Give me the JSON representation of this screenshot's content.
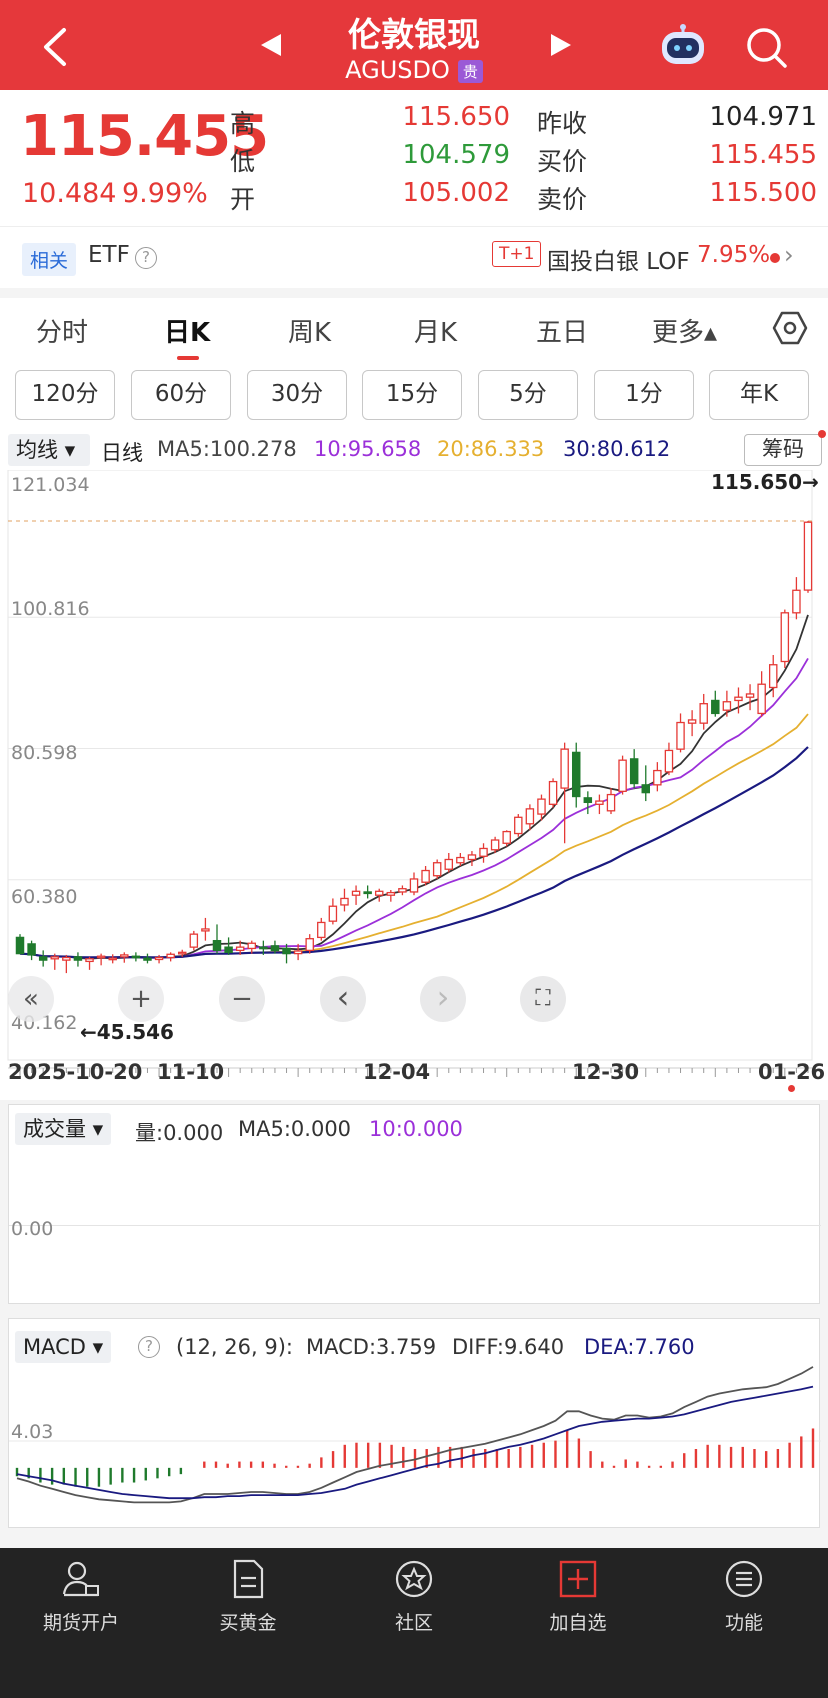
{
  "header": {
    "title": "伦敦银现",
    "symbol": "AGUSDO",
    "tag": "贵"
  },
  "quote": {
    "price": "115.455",
    "change": "10.484",
    "change_pct": "9.99%",
    "high_label": "高",
    "high": "115.650",
    "low_label": "低",
    "low": "104.579",
    "open_label": "开",
    "open": "105.002",
    "prev_close_label": "昨收",
    "prev_close": "104.971",
    "bid_label": "买价",
    "bid": "115.455",
    "ask_label": "卖价",
    "ask": "115.500"
  },
  "related": {
    "tag": "相关",
    "etf": "ETF",
    "help": "?",
    "lof_badge": "T+1",
    "lof_name": "国投白银 LOF",
    "lof_pct": "7.95%",
    "chevron": "›"
  },
  "tabs": [
    "分时",
    "日K",
    "周K",
    "月K",
    "五日",
    "更多▴"
  ],
  "active_tab": "日K",
  "intervals": [
    "120分",
    "60分",
    "30分",
    "15分",
    "5分",
    "1分",
    "年K"
  ],
  "ma_row": {
    "selector": "均线 ▾",
    "line_type": "日线",
    "ma5": "MA5:100.278",
    "ma10": "10:95.658",
    "ma20": "20:86.333",
    "ma30": "30:80.612",
    "chip_button": "筹码"
  },
  "colors": {
    "up": "#e53935",
    "down": "#1f7a2c",
    "ma5": "#333333",
    "ma10": "#9b30d9",
    "ma20": "#e5b030",
    "ma30": "#1a1a80"
  },
  "chart_data": [
    {
      "type": "candlestick",
      "title": "",
      "y_ticks": [
        "121.034",
        "100.816",
        "80.598",
        "60.380",
        "40.162"
      ],
      "ylim": [
        40.162,
        121.034
      ],
      "x_tick_labels": [
        "2025-10-20",
        "11-10",
        "12-04",
        "12-30",
        "01-26"
      ],
      "high_marker": "115.650→",
      "low_marker": "←45.546",
      "x": [
        "10-20",
        "10-21",
        "10-22",
        "10-23",
        "10-24",
        "10-27",
        "10-28",
        "10-29",
        "10-30",
        "10-31",
        "11-03",
        "11-04",
        "11-05",
        "11-06",
        "11-07",
        "11-10",
        "11-11",
        "11-12",
        "11-13",
        "11-14",
        "11-17",
        "11-18",
        "11-19",
        "11-20",
        "11-21",
        "11-24",
        "11-25",
        "11-26",
        "11-27",
        "11-28",
        "12-01",
        "12-02",
        "12-03",
        "12-04",
        "12-05",
        "12-08",
        "12-09",
        "12-10",
        "12-11",
        "12-12",
        "12-15",
        "12-16",
        "12-17",
        "12-18",
        "12-19",
        "12-22",
        "12-23",
        "12-24",
        "12-26",
        "12-29",
        "12-30",
        "12-31",
        "01-02",
        "01-05",
        "01-06",
        "01-07",
        "01-08",
        "01-09",
        "01-12",
        "01-13",
        "01-14",
        "01-15",
        "01-16",
        "01-19",
        "01-20",
        "01-21",
        "01-22",
        "01-23",
        "01-26"
      ],
      "open": [
        51.5,
        50.5,
        48.5,
        48.2,
        48.0,
        48.5,
        47.8,
        48.4,
        48.2,
        48.5,
        48.6,
        48.3,
        48.1,
        48.4,
        49.0,
        50.0,
        52.5,
        51.0,
        50.0,
        49.5,
        49.8,
        50.0,
        50.2,
        49.8,
        49.0,
        49.5,
        51.5,
        54.0,
        56.5,
        58.0,
        58.5,
        58.0,
        58.0,
        58.5,
        58.5,
        60.0,
        61.0,
        62.0,
        63.0,
        63.5,
        64.0,
        65.0,
        66.0,
        67.5,
        69.0,
        70.5,
        72.0,
        74.5,
        80.0,
        73.0,
        72.0,
        71.0,
        74.0,
        79.0,
        75.0,
        75.0,
        77.0,
        80.5,
        84.5,
        84.5,
        88.0,
        86.5,
        88.0,
        88.5,
        86.0,
        90.0,
        94.0,
        101.5,
        105.0
      ],
      "high": [
        52.0,
        51.0,
        49.5,
        49.0,
        48.8,
        49.2,
        48.5,
        49.0,
        48.9,
        49.2,
        49.2,
        49.0,
        48.8,
        49.2,
        49.6,
        52.5,
        54.5,
        53.5,
        51.5,
        51.0,
        51.0,
        51.0,
        51.0,
        50.5,
        50.5,
        52.0,
        54.5,
        57.5,
        59.0,
        59.5,
        59.5,
        59.0,
        58.8,
        59.5,
        61.5,
        62.5,
        63.5,
        64.5,
        64.5,
        64.8,
        66.0,
        67.0,
        68.0,
        70.5,
        72.0,
        73.5,
        76.0,
        81.5,
        81.5,
        74.0,
        73.5,
        74.5,
        79.5,
        80.5,
        78.0,
        78.5,
        81.5,
        86.0,
        86.5,
        89.0,
        89.5,
        89.5,
        90.0,
        90.5,
        92.5,
        95.0,
        102.0,
        107.0,
        115.65
      ],
      "low": [
        49.5,
        48.0,
        47.0,
        46.5,
        46.0,
        47.0,
        46.5,
        47.2,
        47.5,
        47.6,
        47.8,
        47.5,
        47.5,
        47.8,
        48.5,
        49.5,
        51.0,
        49.0,
        48.8,
        48.8,
        49.0,
        48.8,
        49.0,
        47.5,
        48.0,
        49.0,
        51.0,
        53.5,
        55.5,
        56.5,
        57.5,
        57.0,
        57.0,
        58.0,
        58.0,
        59.5,
        60.5,
        61.5,
        62.5,
        62.5,
        63.0,
        64.5,
        65.5,
        67.0,
        68.0,
        69.5,
        71.5,
        66.0,
        71.5,
        70.5,
        70.5,
        70.5,
        73.5,
        74.5,
        72.5,
        74.0,
        76.5,
        80.0,
        82.5,
        83.5,
        85.5,
        85.5,
        86.0,
        86.5,
        85.5,
        88.5,
        93.0,
        100.5,
        104.579
      ],
      "close": [
        49.0,
        48.8,
        48.0,
        48.5,
        48.4,
        48.0,
        48.2,
        48.6,
        48.3,
        48.8,
        48.5,
        48.0,
        48.4,
        48.9,
        49.2,
        52.0,
        52.8,
        49.5,
        49.2,
        50.0,
        50.6,
        49.8,
        49.5,
        49.0,
        49.4,
        51.3,
        53.8,
        56.3,
        57.5,
        58.6,
        58.3,
        58.6,
        58.4,
        59.0,
        60.5,
        61.8,
        63.0,
        63.5,
        63.8,
        64.2,
        65.2,
        66.5,
        67.8,
        70.0,
        71.3,
        72.8,
        75.5,
        80.5,
        73.2,
        72.3,
        72.5,
        73.5,
        78.8,
        75.2,
        73.8,
        77.2,
        80.3,
        84.6,
        85.0,
        87.5,
        86.0,
        87.8,
        88.5,
        89.0,
        90.5,
        93.5,
        101.5,
        104.97,
        115.455
      ]
    },
    {
      "type": "bar",
      "title": "成交量",
      "y_ticks": [
        "0.00"
      ],
      "values": []
    },
    {
      "type": "line",
      "title": "MACD",
      "y_ticks": [
        "4.03"
      ],
      "series": [
        {
          "name": "DIFF",
          "values": [
            -1.0,
            -1.3,
            -1.7,
            -2.0,
            -2.3,
            -2.6,
            -2.8,
            -3.0,
            -3.1,
            -3.2,
            -3.3,
            -3.3,
            -3.3,
            -3.3,
            -3.2,
            -2.9,
            -2.5,
            -2.5,
            -2.5,
            -2.4,
            -2.3,
            -2.3,
            -2.4,
            -2.5,
            -2.5,
            -2.3,
            -1.9,
            -1.4,
            -0.9,
            -0.4,
            -0.1,
            0.2,
            0.4,
            0.6,
            0.8,
            1.1,
            1.4,
            1.7,
            1.9,
            2.1,
            2.3,
            2.6,
            2.9,
            3.2,
            3.6,
            4.0,
            4.5,
            5.4,
            5.4,
            5.0,
            4.7,
            4.6,
            5.0,
            5.0,
            4.8,
            4.9,
            5.2,
            5.8,
            6.3,
            6.8,
            7.1,
            7.3,
            7.5,
            7.6,
            7.7,
            8.0,
            8.5,
            9.0,
            9.64
          ]
        },
        {
          "name": "DEA",
          "values": [
            -0.6,
            -0.8,
            -1.0,
            -1.2,
            -1.5,
            -1.7,
            -1.9,
            -2.1,
            -2.3,
            -2.5,
            -2.6,
            -2.7,
            -2.8,
            -2.9,
            -2.9,
            -2.9,
            -2.8,
            -2.8,
            -2.7,
            -2.7,
            -2.6,
            -2.6,
            -2.6,
            -2.6,
            -2.6,
            -2.5,
            -2.4,
            -2.2,
            -2.0,
            -1.6,
            -1.3,
            -1.0,
            -0.7,
            -0.4,
            -0.1,
            0.2,
            0.4,
            0.7,
            0.9,
            1.2,
            1.4,
            1.7,
            2.0,
            2.2,
            2.5,
            2.8,
            3.2,
            3.6,
            4.0,
            4.2,
            4.4,
            4.5,
            4.6,
            4.7,
            4.7,
            4.8,
            4.9,
            5.1,
            5.4,
            5.7,
            6.0,
            6.3,
            6.5,
            6.7,
            6.9,
            7.1,
            7.3,
            7.5,
            7.76
          ]
        }
      ],
      "histogram_label": "MACD",
      "macd_value": "MACD:3.759",
      "diff_value": "DIFF:9.640",
      "dea_value": "DEA:7.760",
      "params": "(12, 26, 9):"
    }
  ],
  "volume_row": {
    "selector": "成交量 ▾",
    "vol": "量:0.000",
    "ma5": "MA5:0.000",
    "ma10": "10:0.000",
    "tick": "0.00"
  },
  "macd_row": {
    "selector": "MACD ▾",
    "help": "?",
    "params": "(12, 26, 9):",
    "macd": "MACD:3.759",
    "diff": "DIFF:9.640",
    "dea": "DEA:7.760",
    "tick": "4.03"
  },
  "controls": {
    "rewind": "«",
    "zoom_in": "+",
    "zoom_out": "−",
    "left": "‹",
    "right": "›",
    "fullscreen": "⛶"
  },
  "bottom_nav": [
    {
      "label": "期货开户",
      "icon": "account-icon"
    },
    {
      "label": "买黄金",
      "icon": "document-icon"
    },
    {
      "label": "社区",
      "icon": "community-icon"
    },
    {
      "label": "加自选",
      "icon": "add-watchlist-icon"
    },
    {
      "label": "功能",
      "icon": "menu-icon"
    }
  ]
}
